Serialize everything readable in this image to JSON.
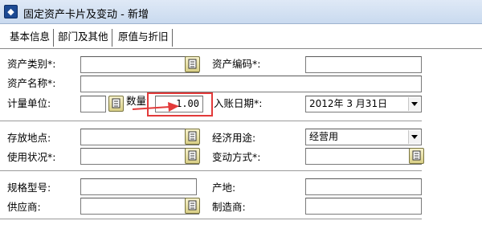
{
  "window": {
    "title": "固定资产卡片及变动 - 新增"
  },
  "tabs": [
    {
      "label": "基本信息"
    },
    {
      "label": "部门及其他"
    },
    {
      "label": "原值与折旧"
    }
  ],
  "form": {
    "asset_category": {
      "label": "资产类别*:",
      "value": ""
    },
    "asset_code": {
      "label": "资产编码*:",
      "value": ""
    },
    "asset_name": {
      "label": "资产名称*:",
      "value": ""
    },
    "unit": {
      "label": "计量单位:",
      "value": ""
    },
    "quantity": {
      "label": "数量:",
      "value": "1.00"
    },
    "entry_date": {
      "label": "入账日期*:",
      "value": "2012年 3 月31日"
    },
    "location": {
      "label": "存放地点:",
      "value": ""
    },
    "economic_use": {
      "label": "经济用途:",
      "value": "经营用"
    },
    "usage_status": {
      "label": "使用状况*:",
      "value": ""
    },
    "change_method": {
      "label": "变动方式*:",
      "value": ""
    },
    "model": {
      "label": "规格型号:",
      "value": ""
    },
    "origin": {
      "label": "产地:",
      "value": ""
    },
    "supplier": {
      "label": "供应商:",
      "value": ""
    },
    "manufacturer": {
      "label": "制造商:",
      "value": ""
    }
  },
  "colors": {
    "highlight": "#e23a3a",
    "lookup_button": "#d9cf86",
    "titlebar": "#c9daef"
  },
  "icons": {
    "lookup": "lookup-book-icon",
    "dropdown": "chevron-down-icon",
    "app": "app-icon"
  }
}
